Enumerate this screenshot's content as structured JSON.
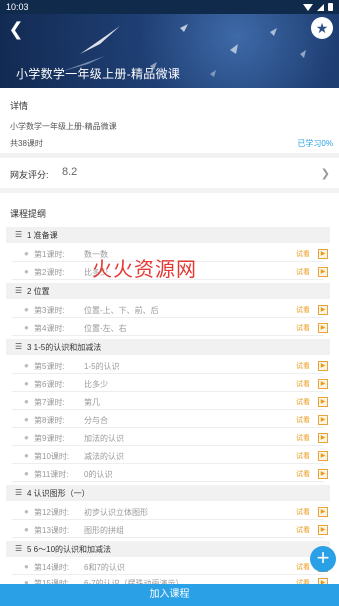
{
  "status_bar": {
    "time": "10:03"
  },
  "header": {
    "title": "小学数学一年级上册-精品微课",
    "back_icon": "arrow-left-icon",
    "favorite_icon": "star-icon"
  },
  "detail": {
    "section_label": "详情",
    "course_name": "小学数学一年级上册-精品微课",
    "lesson_count": "共38课时",
    "progress": "已学习0%"
  },
  "rating": {
    "label": "网友评分:",
    "value": "8.2"
  },
  "outline": {
    "section_label": "课程提纲",
    "trial_label": "试看",
    "chapters": [
      {
        "title": "1 准备课",
        "lessons": [
          {
            "num": "第1课时:",
            "title": "数一数"
          },
          {
            "num": "第2课时:",
            "title": "比多少"
          }
        ]
      },
      {
        "title": "2 位置",
        "lessons": [
          {
            "num": "第3课时:",
            "title": "位置-上、下、前、后"
          },
          {
            "num": "第4课时:",
            "title": "位置-左、右"
          }
        ]
      },
      {
        "title": "3 1-5的认识和加减法",
        "lessons": [
          {
            "num": "第5课时:",
            "title": "1-5的认识"
          },
          {
            "num": "第6课时:",
            "title": "比多少"
          },
          {
            "num": "第7课时:",
            "title": "第几"
          },
          {
            "num": "第8课时:",
            "title": "分与合"
          },
          {
            "num": "第9课时:",
            "title": "加法的认识"
          },
          {
            "num": "第10课时:",
            "title": "减法的认识"
          },
          {
            "num": "第11课时:",
            "title": "0的认识"
          }
        ]
      },
      {
        "title": "4 认识图形（一）",
        "lessons": [
          {
            "num": "第12课时:",
            "title": "初步认识立体图形"
          },
          {
            "num": "第13课时:",
            "title": "图形的拼组"
          }
        ]
      },
      {
        "title": "5 6～10的认识和加减法",
        "lessons": [
          {
            "num": "第14课时:",
            "title": "6和7的认识"
          },
          {
            "num": "第15课时:",
            "title": "6-7的认识（摆珠动画演示）"
          }
        ]
      }
    ]
  },
  "watermark": "火火资源网",
  "fab_icon": "plus-icon",
  "join_button": "加入课程",
  "colors": {
    "accent": "#2aa0e6",
    "trial": "#e89a1a",
    "banner": "#1f3f74"
  }
}
